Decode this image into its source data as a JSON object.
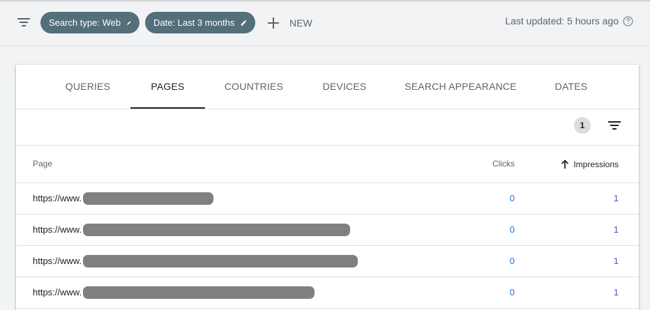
{
  "topbar": {
    "filter_icon": "filter-list-icon",
    "chips": [
      {
        "label": "Search type: Web",
        "icon": "pencil-icon"
      },
      {
        "label": "Date: Last 3 months",
        "icon": "pencil-icon"
      }
    ],
    "new_label": "NEW",
    "last_updated": "Last updated: 5 hours ago",
    "help_icon": "help-circle-icon"
  },
  "tabs": [
    {
      "label": "QUERIES",
      "active": false
    },
    {
      "label": "PAGES",
      "active": true
    },
    {
      "label": "COUNTRIES",
      "active": false
    },
    {
      "label": "DEVICES",
      "active": false
    },
    {
      "label": "SEARCH APPEARANCE",
      "active": false
    },
    {
      "label": "DATES",
      "active": false
    }
  ],
  "toolbar": {
    "active_filter_count": "1",
    "filter_icon": "filter-list-icon"
  },
  "table": {
    "columns": {
      "page": "Page",
      "clicks": "Clicks",
      "impressions": "Impressions",
      "sort_icon": "arrow-up-icon"
    },
    "rows": [
      {
        "page_prefix": "https://www.",
        "clicks": "0",
        "impressions": "1"
      },
      {
        "page_prefix": "https://www.",
        "clicks": "0",
        "impressions": "1"
      },
      {
        "page_prefix": "https://www.",
        "clicks": "0",
        "impressions": "1"
      },
      {
        "page_prefix": "https://www.",
        "clicks": "0",
        "impressions": "1"
      }
    ]
  },
  "colors": {
    "chip_bg": "#546e7a",
    "clicks": "#1a73e8",
    "impressions": "#7b3fb8",
    "redaction": "#808080"
  }
}
